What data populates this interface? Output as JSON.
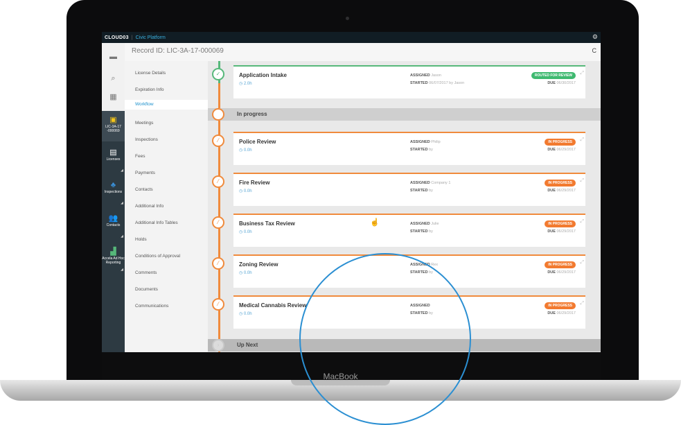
{
  "device": {
    "brand": "MacBook"
  },
  "topbar": {
    "logo": "CLOUD03",
    "separator": "|",
    "app_name": "Civic Platform"
  },
  "record": {
    "id_label": "Record ID: LIC-3A-17-000069"
  },
  "leftnav": {
    "active_record": "LIC-3A-17 -000069",
    "tiles": [
      {
        "label": "Licenses"
      },
      {
        "label": "Inspections"
      },
      {
        "label": "Contacts"
      },
      {
        "label": "Accela Ad Hoc Reporting"
      }
    ]
  },
  "sections": [
    "License Details",
    "Expiration Info",
    "Workflow",
    "Meetings",
    "Inspections",
    "Fees",
    "Payments",
    "Contacts",
    "Additional Info",
    "Additional Info Tables",
    "Holds",
    "Conditions of Approval",
    "Comments",
    "Documents",
    "Communications"
  ],
  "groups": {
    "in_progress": "In progress",
    "up_next": "Up Next"
  },
  "labels": {
    "assigned": "ASSIGNED",
    "started": "STARTED",
    "due": "DUE"
  },
  "tasks": [
    {
      "title": "Application Intake",
      "duration": "2.0h",
      "assignee": "Jason",
      "started": "06/07/2017 by Jason",
      "status": "ROUTED FOR REVIEW",
      "due": "06/30/2017"
    },
    {
      "title": "Police Review",
      "duration": "0.0h",
      "assignee": "Philip",
      "started": "by",
      "status": "IN PROGRESS",
      "due": "06/29/2017"
    },
    {
      "title": "Fire Review",
      "duration": "0.0h",
      "assignee": "Company 1",
      "started": "by",
      "status": "IN PROGRESS",
      "due": "06/29/2017"
    },
    {
      "title": "Business Tax Review",
      "duration": "0.0h",
      "assignee": "Julie",
      "started": "by",
      "status": "IN PROGRESS",
      "due": "06/29/2017"
    },
    {
      "title": "Zoning Review",
      "duration": "0.0h",
      "assignee": "Rex",
      "started": "by",
      "status": "IN PROGRESS",
      "due": "06/29/2017"
    },
    {
      "title": "Medical Cannabis Review",
      "duration": "0.0h",
      "assignee": "",
      "started": "by",
      "status": "IN PROGRESS",
      "due": "06/29/2017"
    }
  ],
  "colors": {
    "accent_orange": "#f08a3c",
    "accent_green": "#56b87a",
    "overlay_blue": "#2b8fd2",
    "link_blue": "#1a8fcc"
  }
}
